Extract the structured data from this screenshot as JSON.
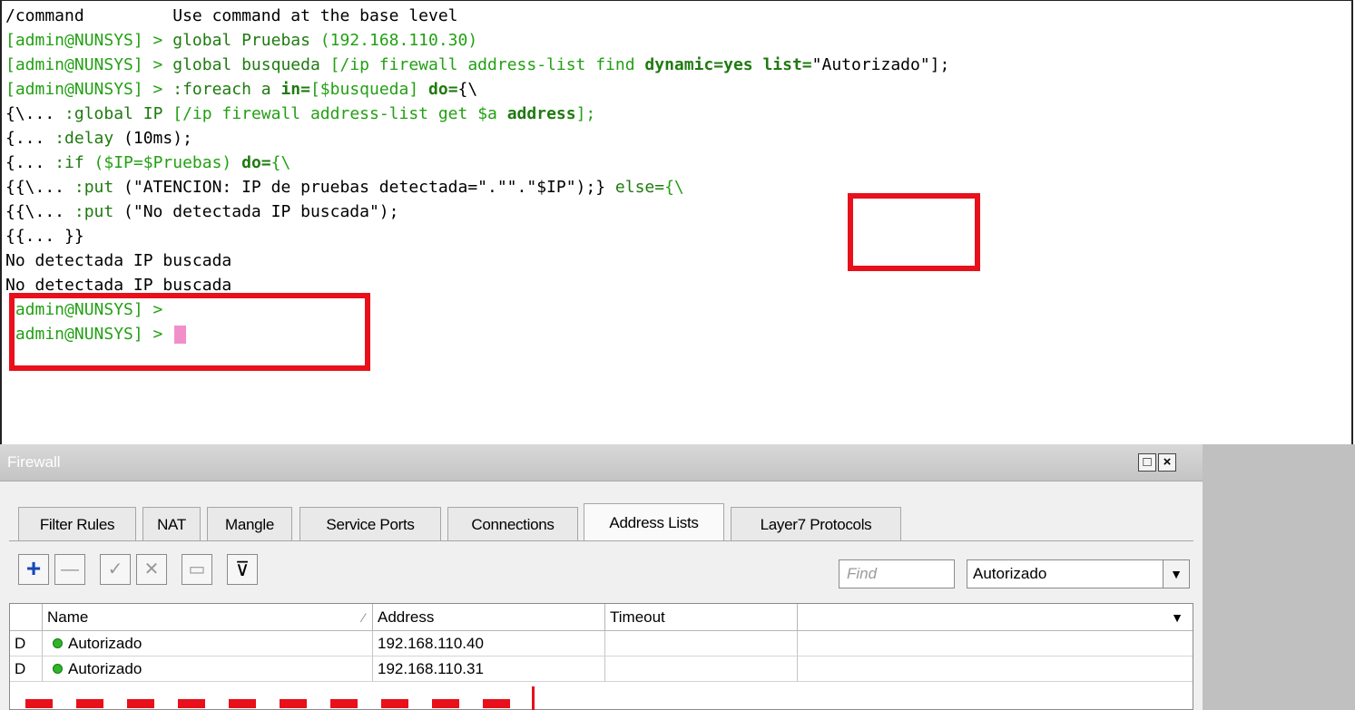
{
  "terminal": {
    "lines": [
      {
        "a": "/command         Use command at the base level"
      },
      {
        "prompt": "[admin@NUNSYS] > ",
        "cmd": "global Pruebas ",
        "arg": "(192.168.110.30)"
      },
      {
        "prompt": "[admin@NUNSYS] > ",
        "cmd": "global busqueda ",
        "arg": "[/ip firewall address-list find ",
        "kw": "dynamic=yes list=",
        "str": "\"Autorizado\"];"
      },
      {
        "prompt": "[admin@NUNSYS] > ",
        "cmd": ":foreach a ",
        "kw": "in=",
        "arg": "[$busqueda] ",
        "kw2": "do=",
        "rest": "{\\"
      },
      {
        "a": "{\\... ",
        "cmd": ":global IP ",
        "arg": "[/ip firewall address-list get ",
        "var": "$a ",
        "kw": "address",
        "rest": "];"
      },
      {
        "a": "{... ",
        "cmd": ":delay ",
        "arg": "(10ms);"
      },
      {
        "a": "{... ",
        "cmd": ":if ",
        "arg": "($IP=$Pruebas) ",
        "kw": "do=",
        "rest": "{\\"
      },
      {
        "a": "{{\\... ",
        "cmd": ":put ",
        "arg": "(\"ATENCION: IP de pruebas detectada=\".\"\".\"$IP\");}",
        "kw": " else=",
        "rest": "{\\"
      },
      {
        "a": "{{\\... ",
        "cmd": ":put ",
        "arg": "(\"No detectada IP buscada\");"
      },
      {
        "a": "{{... }}"
      },
      {
        "a": "No detectada IP buscada"
      },
      {
        "a": "No detectada IP buscada"
      },
      {
        "prompt": "[admin@NUNSYS] > "
      },
      {
        "prompt": "[admin@NUNSYS] > "
      }
    ]
  },
  "firewall": {
    "title": "Firewall",
    "restore_icon": "□",
    "close_icon": "×",
    "tabs": [
      "Filter Rules",
      "NAT",
      "Mangle",
      "Service Ports",
      "Connections",
      "Address Lists",
      "Layer7 Protocols"
    ],
    "active_tab": "Address Lists",
    "toolbar": {
      "add_icon": "+",
      "remove_icon": "—",
      "enable_icon": "✓",
      "disable_icon": "✕",
      "comment_icon": "▭",
      "filter_icon": "⊽"
    },
    "find_placeholder": "Find",
    "list_filter_value": "Autorizado",
    "list_filter_arrow": "▼",
    "columns": {
      "name": "Name",
      "sort_indicator": "∕",
      "address": "Address",
      "timeout": "Timeout",
      "menu_arrow": "▼"
    },
    "rows": [
      {
        "flag": "D",
        "name": "Autorizado",
        "address": "192.168.110.40",
        "timeout": ""
      },
      {
        "flag": "D",
        "name": "Autorizado",
        "address": "192.168.110.31",
        "timeout": ""
      }
    ]
  },
  "colors": {
    "highlight": "#e8101b",
    "prompt": "#23a014",
    "cursor": "#f08fc9",
    "status_dot": "#2fb52a"
  }
}
